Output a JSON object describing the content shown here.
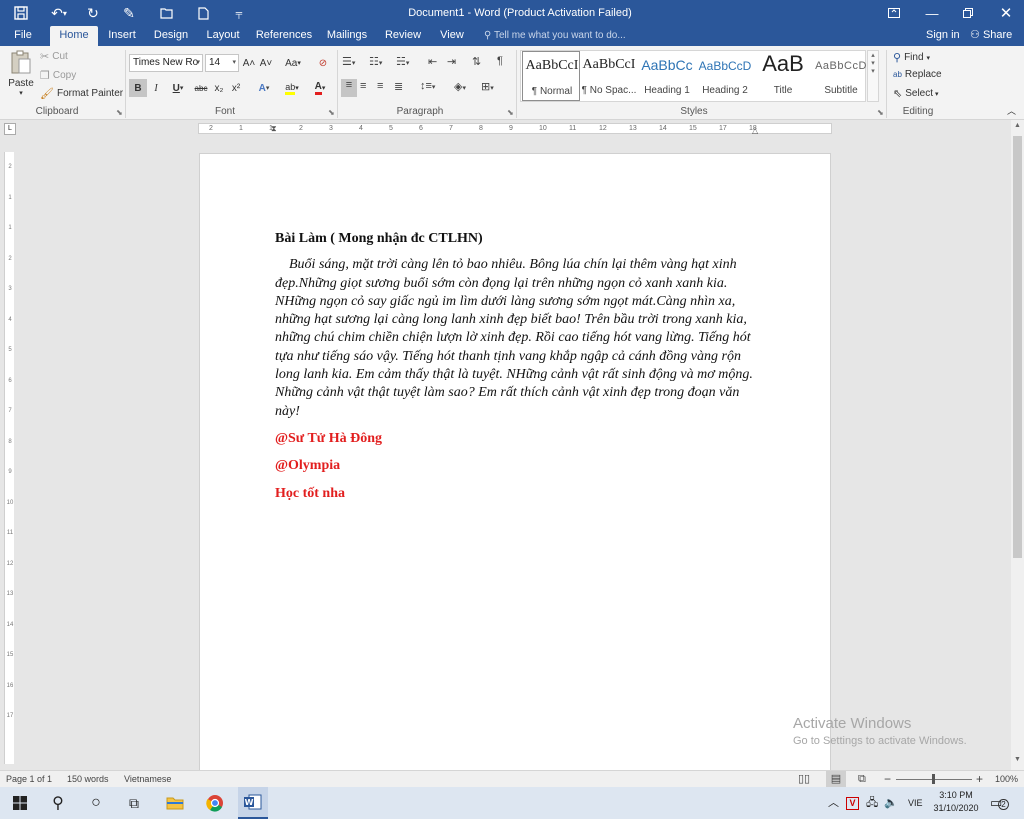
{
  "window": {
    "title": "Document1 - Word (Product Activation Failed)",
    "quick_access": {
      "save": "save-icon",
      "undo": "undo-icon",
      "redo": "redo-icon",
      "touch": "touch-mode-icon",
      "open": "open-icon",
      "new": "new-document-icon",
      "customize": "customize-icon"
    }
  },
  "tabs": [
    "File",
    "Home",
    "Insert",
    "Design",
    "Layout",
    "References",
    "Mailings",
    "Review",
    "View"
  ],
  "active_tab": "Home",
  "tell_me": {
    "placeholder": "Tell me what you want to do..."
  },
  "account": {
    "sign_in": "Sign in",
    "share": "Share"
  },
  "ribbon": {
    "clipboard": {
      "paste": "Paste",
      "cut": "Cut",
      "copy": "Copy",
      "format_painter": "Format Painter",
      "label": "Clipboard"
    },
    "font": {
      "name": "Times New Ro",
      "size": "14",
      "label": "Font",
      "bold": "B",
      "italic": "I",
      "underline": "U",
      "strike": "abc",
      "subscript": "x₂",
      "superscript": "x²",
      "grow": "A˄",
      "shrink": "A˅",
      "case": "Aa",
      "clear": "⊘",
      "effects": "A",
      "highlight": "ab",
      "color": "A"
    },
    "paragraph": {
      "label": "Paragraph"
    },
    "styles": {
      "label": "Styles",
      "items": [
        {
          "sample": "AaBbCcI",
          "label": "¶ Normal"
        },
        {
          "sample": "AaBbCcI",
          "label": "¶ No Spac..."
        },
        {
          "sample": "AaBbCc",
          "label": "Heading 1"
        },
        {
          "sample": "AaBbCcD",
          "label": "Heading 2"
        },
        {
          "sample": "AaB",
          "label": "Title"
        },
        {
          "sample": "AaBbCcD",
          "label": "Subtitle"
        }
      ]
    },
    "editing": {
      "label": "Editing",
      "find": "Find",
      "replace": "Replace",
      "select": "Select"
    }
  },
  "ruler_h": [
    "2",
    "1",
    "1",
    "2",
    "3",
    "4",
    "5",
    "6",
    "7",
    "8",
    "9",
    "10",
    "11",
    "12",
    "13",
    "14",
    "15",
    "17",
    "18"
  ],
  "ruler_v": [
    "2",
    "1",
    "1",
    "2",
    "3",
    "4",
    "5",
    "6",
    "7",
    "8",
    "9",
    "10",
    "11",
    "12",
    "13",
    "14",
    "15",
    "16",
    "17"
  ],
  "document": {
    "heading": "Bài Làm ( Mong nhận đc CTLHN)",
    "body": "Buổi sáng, mặt trời càng lên tỏ bao nhiêu. Bông lúa chín lại thêm vàng hạt xinh đẹp.Những giọt sương buổi sớm còn đọng lại trên những ngọn cỏ xanh xanh kia. NHững ngọn cỏ say giấc ngủ im lìm dưới làng sương sớm ngọt mát.Càng nhìn xa, những hạt sương lại càng long lanh xinh đẹp biết bao! Trên bầu trời trong xanh kia, những chú chim chiền chiện lượn lờ xinh đẹp. Rồi cao tiếng hót vang lừng. Tiếng hót tựa như tiếng sáo vậy. Tiếng hót thanh tịnh vang khắp ngập cả cánh đồng vàng rộn long lanh kia. Em cảm thấy thật là tuyệt. NHững cảnh vật rất sinh động và mơ mộng. Những cảnh vật thật tuyệt làm sao? Em rất thích cảnh vật xinh đẹp trong đoạn văn này!",
    "signatures": [
      "@Sư Tử Hà Đông",
      "@Olympia",
      "Học tốt nha"
    ],
    "signature_color": "#e21e1e"
  },
  "watermark": {
    "line1": "Activate Windows",
    "line2": "Go to Settings to activate Windows."
  },
  "status": {
    "page": "Page 1 of 1",
    "words": "150 words",
    "language": "Vietnamese",
    "zoom": "100%"
  },
  "taskbar": {
    "lang": "VIE",
    "time": "3:10 PM",
    "date": "31/10/2020",
    "notifications": "2"
  },
  "colors": {
    "accent": "#2b579a",
    "red": "#e21e1e"
  }
}
